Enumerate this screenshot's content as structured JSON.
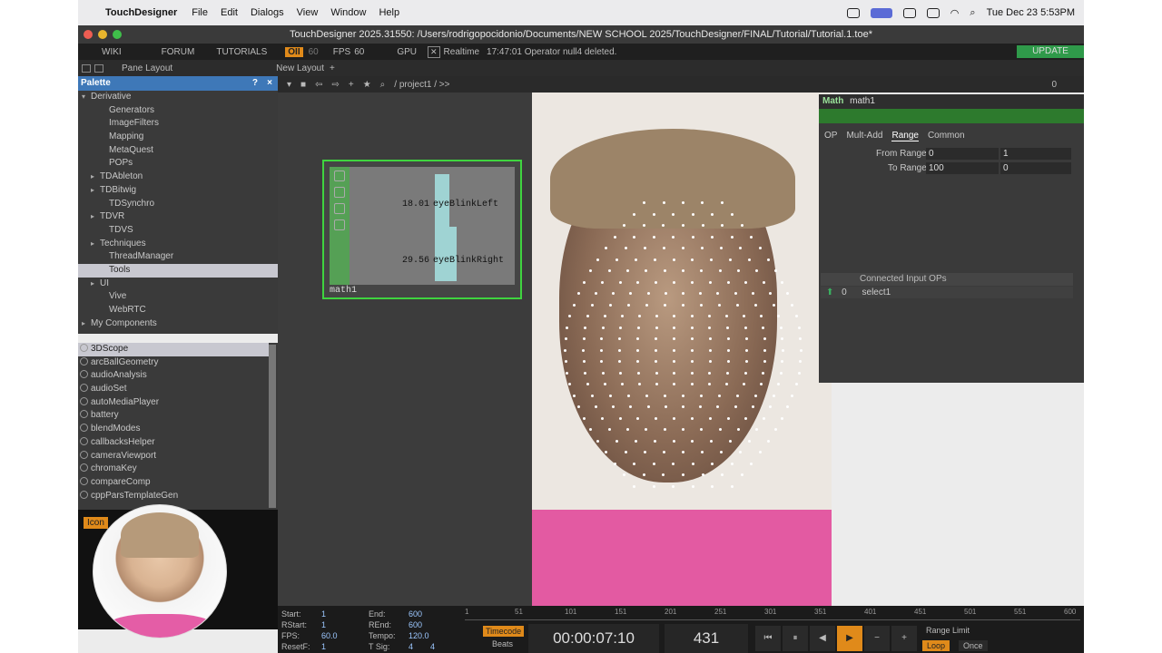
{
  "menubar": {
    "app": "TouchDesigner",
    "items": [
      "File",
      "Edit",
      "Dialogs",
      "View",
      "Window",
      "Help"
    ],
    "clock": "Tue Dec 23  5:53PM"
  },
  "window": {
    "title": "TouchDesigner 2025.31550: /Users/rodrigopocidonio/Documents/NEW SCHOOL 2025/TouchDesigner/FINAL/Tutorial/Tutorial.1.toe*"
  },
  "toolbar": {
    "wiki": "WIKI",
    "forum": "FORUM",
    "tutorials": "TUTORIALS",
    "oii": "OII",
    "oii_num": "60",
    "fps_label": "FPS",
    "fps": "60",
    "gpu": "GPU",
    "realtime": "Realtime",
    "status": "17:47:01 Operator null4 deleted.",
    "update": "UPDATE"
  },
  "panebar": {
    "pane_layout": "Pane Layout",
    "new_layout": "New Layout"
  },
  "netbar": {
    "path": "/ project1 / >>",
    "count": "0"
  },
  "palette": {
    "title": "Palette",
    "help": "?",
    "close": "×",
    "tree": [
      {
        "label": "Derivative",
        "indent": 0,
        "arrow": "▾"
      },
      {
        "label": "Generators",
        "indent": 2,
        "arrow": ""
      },
      {
        "label": "ImageFilters",
        "indent": 2,
        "arrow": ""
      },
      {
        "label": "Mapping",
        "indent": 2,
        "arrow": ""
      },
      {
        "label": "MetaQuest",
        "indent": 2,
        "arrow": ""
      },
      {
        "label": "POPs",
        "indent": 2,
        "arrow": ""
      },
      {
        "label": "TDAbleton",
        "indent": 1,
        "arrow": "▸"
      },
      {
        "label": "TDBitwig",
        "indent": 1,
        "arrow": "▸"
      },
      {
        "label": "TDSynchro",
        "indent": 2,
        "arrow": ""
      },
      {
        "label": "TDVR",
        "indent": 1,
        "arrow": "▸"
      },
      {
        "label": "TDVS",
        "indent": 2,
        "arrow": ""
      },
      {
        "label": "Techniques",
        "indent": 1,
        "arrow": "▸"
      },
      {
        "label": "ThreadManager",
        "indent": 2,
        "arrow": ""
      },
      {
        "label": "Tools",
        "indent": 2,
        "arrow": "",
        "selected": true
      },
      {
        "label": "UI",
        "indent": 1,
        "arrow": "▸"
      },
      {
        "label": "Vive",
        "indent": 2,
        "arrow": ""
      },
      {
        "label": "WebRTC",
        "indent": 2,
        "arrow": ""
      },
      {
        "label": "My Components",
        "indent": 0,
        "arrow": "▸"
      }
    ],
    "components": [
      "3DScope",
      "arcBallGeometry",
      "audioAnalysis",
      "audioSet",
      "autoMediaPlayer",
      "battery",
      "blendModes",
      "callbacksHelper",
      "cameraViewport",
      "chromaKey",
      "compareComp",
      "cppParsTemplateGen"
    ],
    "icon_tab": "Icon"
  },
  "node": {
    "name": "math1",
    "channels": [
      {
        "value": "18.01",
        "name": "eyeBlinkLeft"
      },
      {
        "value": "29.56",
        "name": "eyeBlinkRight"
      }
    ]
  },
  "params": {
    "type": "Math",
    "name": "math1",
    "tabs": [
      "OP",
      "Mult-Add",
      "Range",
      "Common"
    ],
    "active_tab": "Range",
    "rows": [
      {
        "label": "From Range",
        "v1": "0",
        "v2": "1"
      },
      {
        "label": "To Range",
        "v1": "100",
        "v2": "0"
      }
    ],
    "connected_header": "Connected Input OPs",
    "connected": [
      {
        "index": "0",
        "name": "select1"
      }
    ]
  },
  "timeline": {
    "start_label": "Start:",
    "start": "1",
    "rstart_label": "RStart:",
    "rstart": "1",
    "fps_label": "FPS:",
    "fps": "60.0",
    "resetf_label": "ResetF:",
    "resetf": "1",
    "end_label": "End:",
    "end": "600",
    "rend_label": "REnd:",
    "rend": "600",
    "tempo_label": "Tempo:",
    "tempo": "120.0",
    "tsig_label": "T Sig:",
    "tsig_a": "4",
    "tsig_b": "4",
    "timecode_label": "Timecode",
    "beats_label": "Beats",
    "timecode": "00:00:07:10",
    "frame": "431",
    "ticks": [
      "1",
      "51",
      "101",
      "151",
      "201",
      "251",
      "301",
      "351",
      "401",
      "451",
      "501",
      "551",
      "600"
    ],
    "range_limit": "Range Limit",
    "loop": "Loop",
    "once": "Once"
  }
}
